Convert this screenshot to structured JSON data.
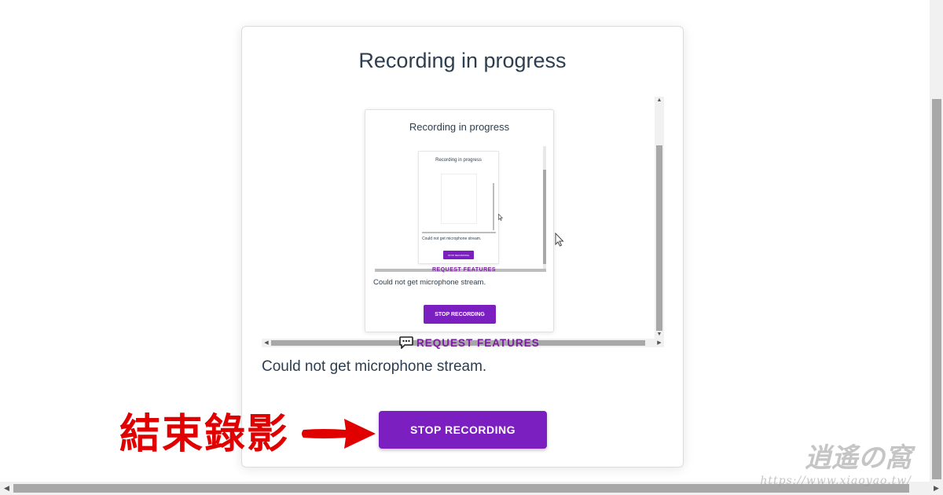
{
  "card": {
    "title": "Recording in progress",
    "request_features": "REQUEST FEATURES",
    "error_text": "Could not get microphone stream.",
    "stop_button": "STOP RECORDING"
  },
  "preview": {
    "title": "Recording in progress",
    "request_features": "REQUEST FEATURES",
    "error_text": "Could not get microphone stream.",
    "stop_button": "STOP RECORDING"
  },
  "preview_inner": {
    "title": "Recording in progress",
    "error_text": "Could not get microphone stream.",
    "stop_button": "STOP RECORDING"
  },
  "annotation": {
    "label": "結束錄影"
  },
  "watermark": {
    "line1": "逍遙の窩",
    "line2": "https://www.xiaoyao.tw/"
  },
  "colors": {
    "accent": "#7b1fc0",
    "annotation": "#e00000",
    "text": "#2c3e50"
  }
}
